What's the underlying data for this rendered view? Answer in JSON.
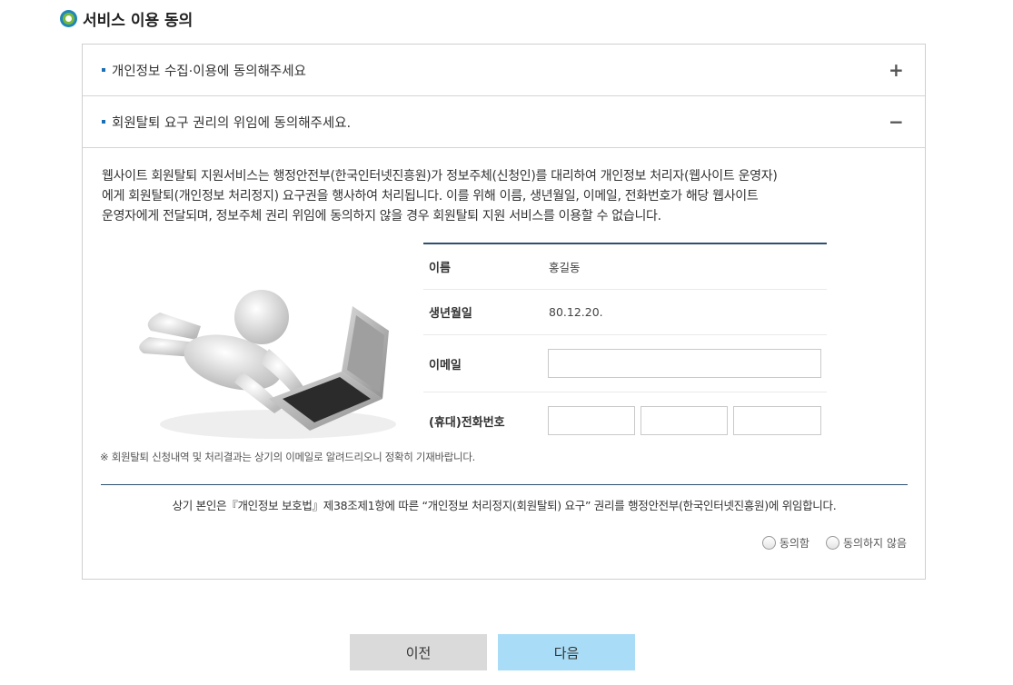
{
  "section": {
    "title": "서비스 이용 동의"
  },
  "accordion": [
    {
      "label": "개인정보 수집·이용에 동의해주세요",
      "toggle": "+"
    },
    {
      "label": "회원탈퇴 요구 권리의 위임에 동의해주세요.",
      "toggle": "−"
    }
  ],
  "description": [
    "웹사이트 회원탈퇴 지원서비스는 행정안전부(한국인터넷진흥원)가 정보주체(신청인)를 대리하여 개인정보 처리자(웹사이트 운영자)",
    "에게 회원탈퇴(개인정보 처리정지) 요구권을 행사하여 처리됩니다. 이를 위해 이름, 생년월일, 이메일, 전화번호가 해당 웹사이트",
    "운영자에게 전달되며, 정보주체 권리 위임에 동의하지 않을 경우 회원탈퇴 지원 서비스를 이용할 수 없습니다."
  ],
  "form": {
    "name_label": "이름",
    "name_value": "홍길동",
    "birth_label": "생년월일",
    "birth_value": "80.12.20.",
    "email_label": "이메일",
    "email_value": "",
    "phone_label": "(휴대)전화번호",
    "phone_values": [
      "",
      "",
      ""
    ]
  },
  "notice": "※ 회원탈퇴 신청내역 및 처리결과는 상기의 이메일로 알려드리오니 정확히 기재바랍니다.",
  "consent_text": "상기 본인은『개인정보 보호법』제38조제1항에 따른 “개인정보 처리정지(회원탈퇴) 요구” 권리를 행정안전부(한국인터넷진흥원)에 위임합니다.",
  "radios": {
    "agree": "동의함",
    "disagree": "동의하지 않음"
  },
  "buttons": {
    "prev": "이전",
    "next": "다음"
  },
  "colors": {
    "accent": "#2e4f6f",
    "next_button": "#a9dcf6",
    "prev_button": "#dadada",
    "bullet": "#1a6fb5"
  }
}
